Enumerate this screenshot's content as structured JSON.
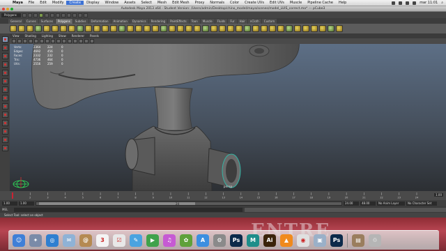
{
  "mac_menu": {
    "apple": "",
    "items": [
      "Maya",
      "File",
      "Edit",
      "Modify",
      "Create",
      "Display",
      "Window",
      "Assets",
      "Select",
      "Mesh",
      "Edit Mesh",
      "Proxy",
      "Normals",
      "Color",
      "Create UVs",
      "Edit UVs",
      "Muscle",
      "Pipeline Cache",
      "Help"
    ],
    "clock": "mar 11:01"
  },
  "window": {
    "title": "Autodesk Maya 2013 x64 - Student Version: /Users/admin/Desktop/chino_model/maya/scenes/model_LUIS_correct.ma* --- pCube3"
  },
  "status_line": {
    "mode": "Polygons"
  },
  "shelf_tabs": [
    {
      "label": "General",
      "active": false
    },
    {
      "label": "Curves",
      "active": false
    },
    {
      "label": "Surfaces",
      "active": false
    },
    {
      "label": "Polygons",
      "active": true
    },
    {
      "label": "Subdivs",
      "active": false
    },
    {
      "label": "Deformation",
      "active": false
    },
    {
      "label": "Animation",
      "active": false
    },
    {
      "label": "Dynamics",
      "active": false
    },
    {
      "label": "Rendering",
      "active": false
    },
    {
      "label": "PaintEffects",
      "active": false
    },
    {
      "label": "Toon",
      "active": false
    },
    {
      "label": "Muscle",
      "active": false
    },
    {
      "label": "Fluids",
      "active": false
    },
    {
      "label": "Fur",
      "active": false
    },
    {
      "label": "Hair",
      "active": false
    },
    {
      "label": "nCloth",
      "active": false
    },
    {
      "label": "Custom",
      "active": false
    }
  ],
  "view_menu": [
    "View",
    "Shading",
    "Lighting",
    "Show",
    "Renderer",
    "Panels"
  ],
  "hud": {
    "rows": [
      {
        "label": "Verts:",
        "a": "2364",
        "b": "224",
        "c": "0"
      },
      {
        "label": "Edges:",
        "a": "4692",
        "b": "456",
        "c": "0"
      },
      {
        "label": "Faces:",
        "a": "2332",
        "b": "232",
        "c": "0"
      },
      {
        "label": "Tris:",
        "a": "4736",
        "b": "464",
        "c": "0"
      },
      {
        "label": "UVs:",
        "a": "2556",
        "b": "259",
        "c": "0"
      }
    ]
  },
  "camera_label": "persp",
  "timeline": {
    "ticks": [
      "1",
      "2",
      "3",
      "4",
      "5",
      "6",
      "7",
      "8",
      "9",
      "10",
      "11",
      "12",
      "13",
      "14",
      "15",
      "16",
      "17",
      "18",
      "19",
      "20",
      "21",
      "22",
      "23",
      "24"
    ],
    "current": "1.00"
  },
  "range": {
    "start": "1.00",
    "inner_start": "1.00",
    "slider_label": "24",
    "inner_end": "24.00",
    "end": "48.00",
    "anim_layer": "No Anim Layer",
    "char_set": "No Character Set"
  },
  "cmd": {
    "label": "MEL"
  },
  "help_line": "Select Tool: select an object",
  "desktop_text": "ENTRE",
  "dock_icons": [
    {
      "name": "finder",
      "color": "#3f7fd7",
      "glyph": "☺"
    },
    {
      "name": "launchpad",
      "color": "#7a8ba8",
      "glyph": "✦"
    },
    {
      "name": "safari",
      "color": "#2f7fd0",
      "glyph": "◎"
    },
    {
      "name": "mail",
      "color": "#8fb2d6",
      "glyph": "✉"
    },
    {
      "name": "contacts",
      "color": "#b58a52",
      "glyph": "@"
    },
    {
      "name": "calendar",
      "color": "#f4f4f4",
      "glyph": "3"
    },
    {
      "name": "reminders",
      "color": "#e8e8e8",
      "glyph": "☑"
    },
    {
      "name": "messages",
      "color": "#4aa3e0",
      "glyph": "✎"
    },
    {
      "name": "facetime",
      "color": "#3fa24b",
      "glyph": "▶"
    },
    {
      "name": "itunes",
      "color": "#c65ad3",
      "glyph": "♫"
    },
    {
      "name": "iphoto",
      "color": "#5fa13a",
      "glyph": "✿"
    },
    {
      "name": "app-store",
      "color": "#3c8fe0",
      "glyph": "A"
    },
    {
      "name": "system-preferences",
      "color": "#8a8a8a",
      "glyph": "⚙"
    },
    {
      "name": "photoshop",
      "color": "#0b2a4a",
      "glyph": "Ps"
    },
    {
      "name": "maya",
      "color": "#1e8e8a",
      "glyph": "M"
    },
    {
      "name": "illustrator",
      "color": "#3a230a",
      "glyph": "Ai"
    },
    {
      "name": "vlc",
      "color": "#f08a1c",
      "glyph": "▲"
    },
    {
      "name": "chrome",
      "color": "#e0e0e0",
      "glyph": "◉"
    },
    {
      "name": "preview",
      "color": "#9ab0c8",
      "glyph": "▣"
    },
    {
      "name": "photoshop-2",
      "color": "#0b2a4a",
      "glyph": "Ps"
    },
    {
      "name": "documents",
      "color": "#9a7e5e",
      "glyph": "▤"
    },
    {
      "name": "trash",
      "color": "#b5b5b5",
      "glyph": "♲"
    }
  ]
}
